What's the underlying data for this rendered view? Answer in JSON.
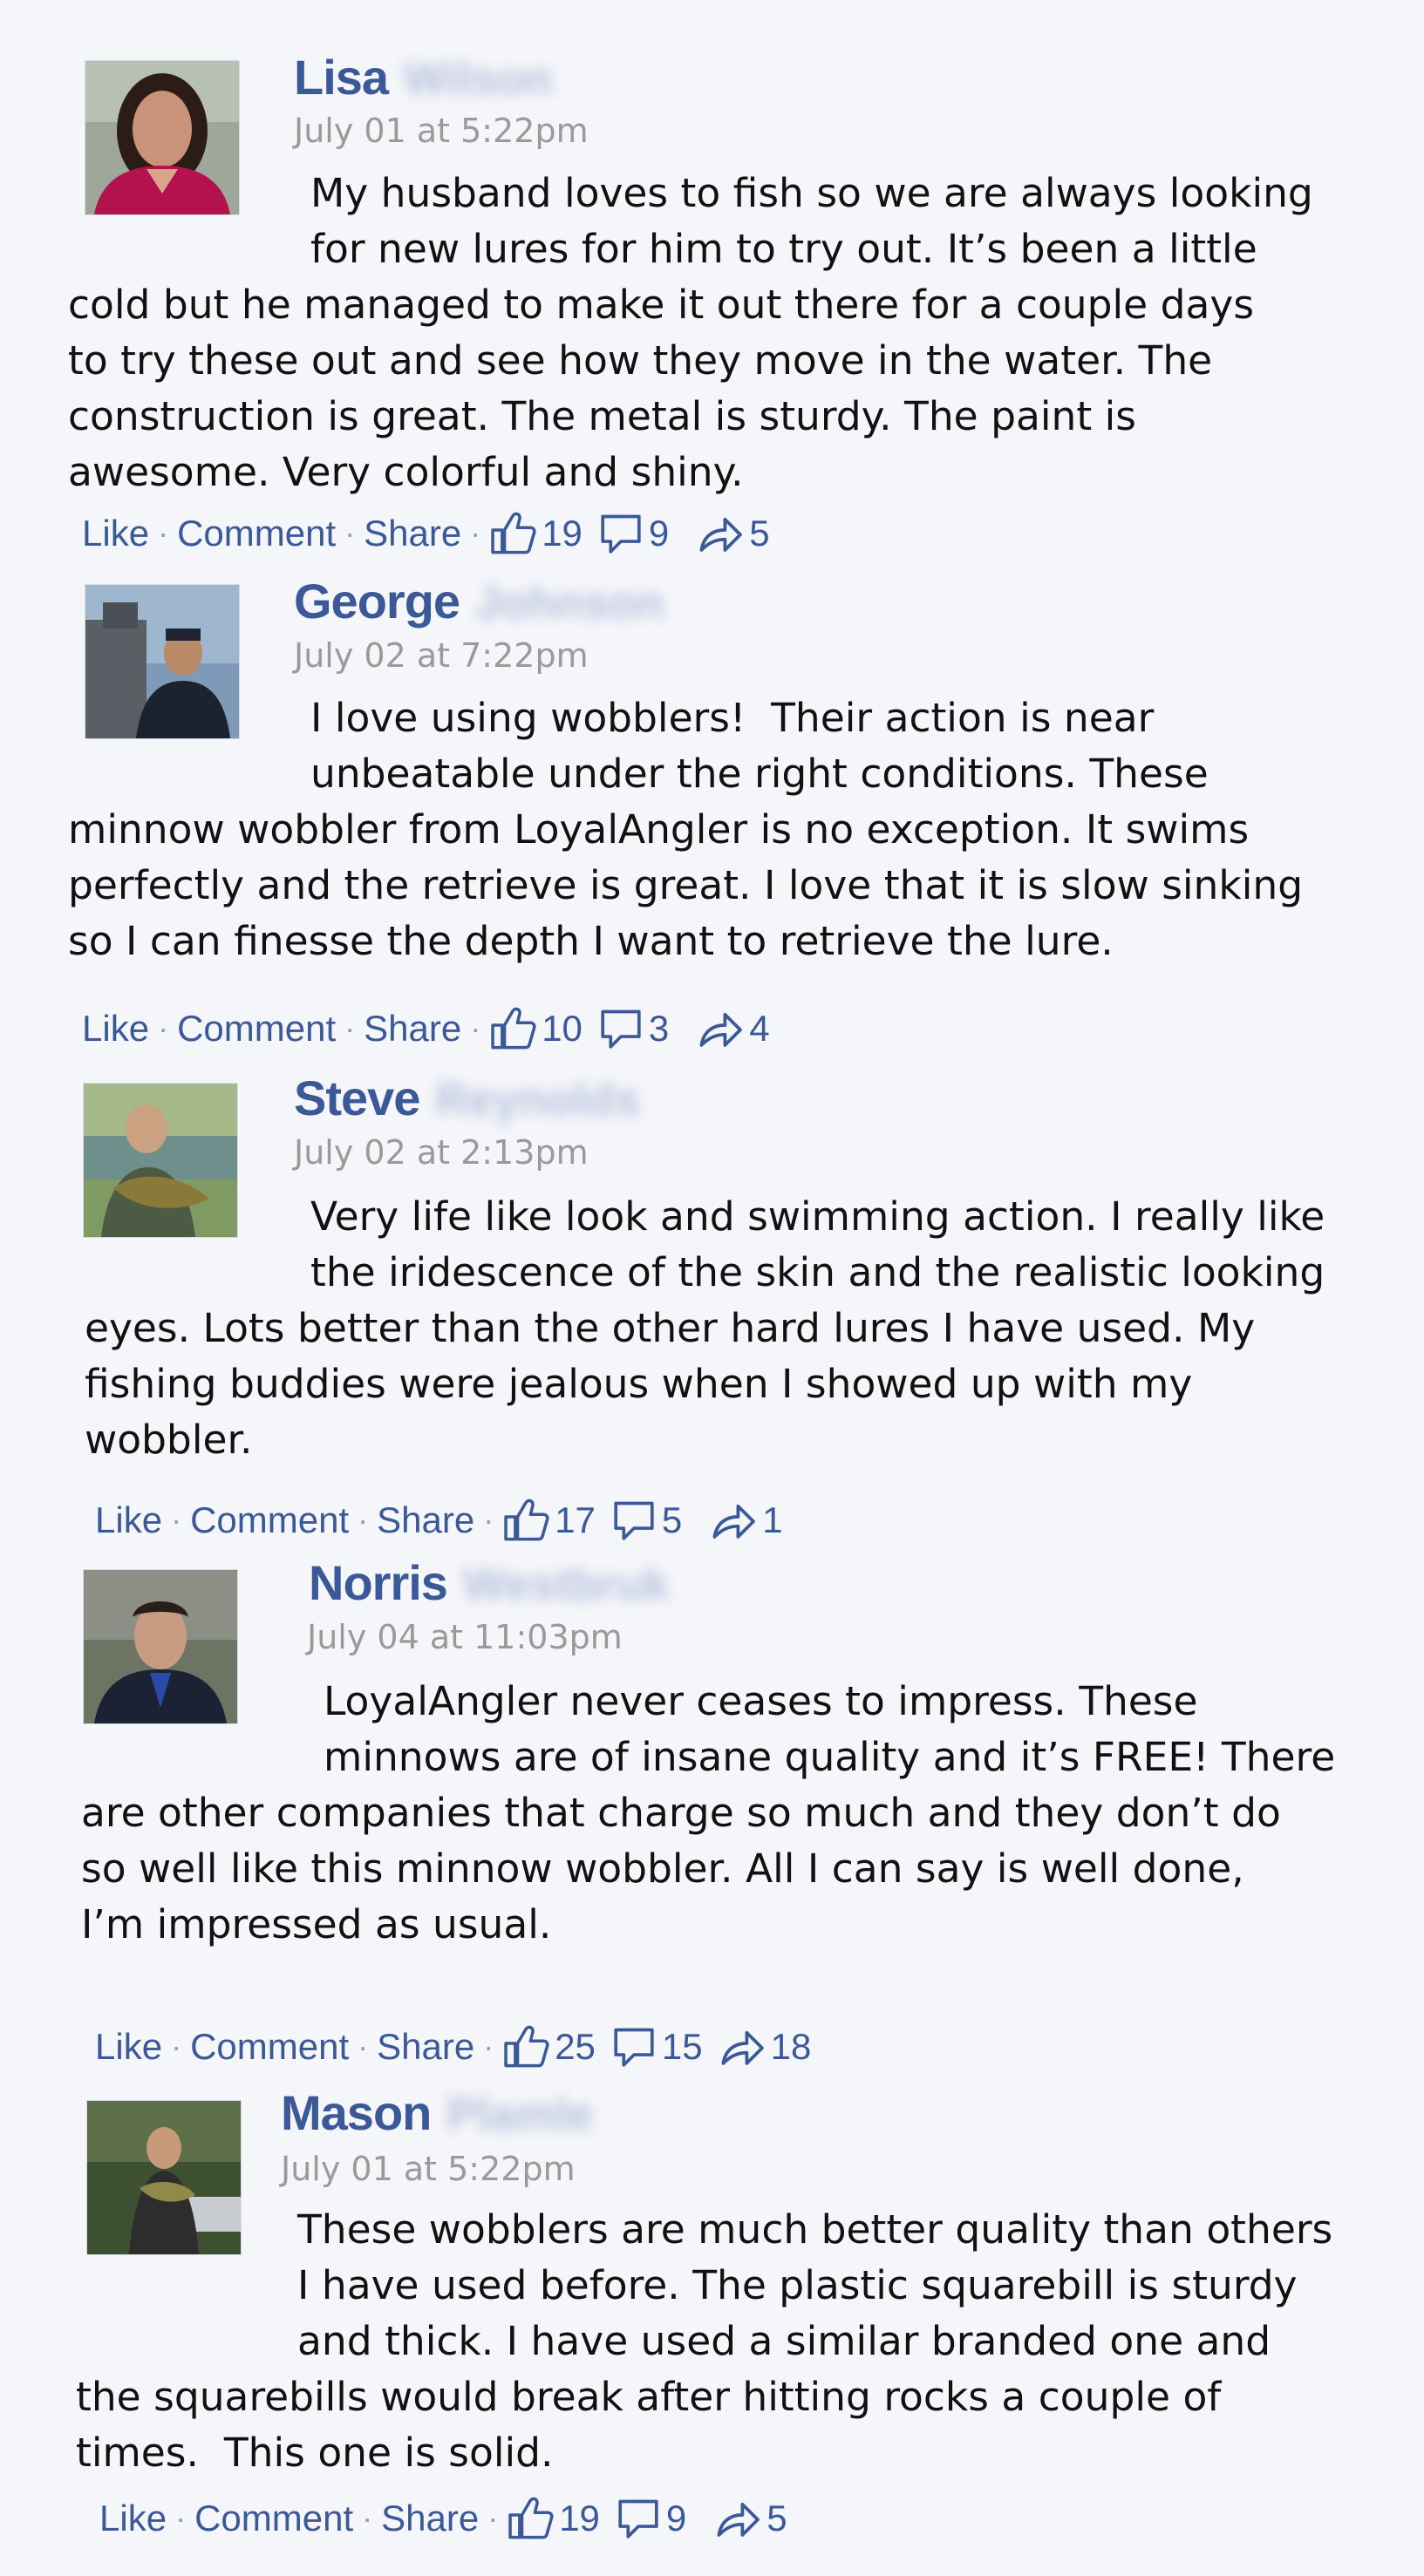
{
  "actions": {
    "like": "Like",
    "comment": "Comment",
    "share": "Share",
    "sep": "·"
  },
  "colors": {
    "link": "#3b5998",
    "timestamp": "#9a9a9a",
    "text": "#111111",
    "background": "#f5f6fa"
  },
  "comments": [
    {
      "first_name": "Lisa",
      "last_name": "Wilson",
      "timestamp": "July 01 at 5:22pm",
      "lines_indented": [
        "My husband loves to fish so we are always looking",
        "for new lures for him to try out. It’s been a little"
      ],
      "lines_full": [
        "cold but he managed to make it out there for a couple days",
        "to try these out and see how they move in the water. The",
        "construction is great. The metal is sturdy. The paint is",
        "awesome. Very colorful and shiny."
      ],
      "likes": "19",
      "comments": "9",
      "shares": "5"
    },
    {
      "first_name": "George",
      "last_name": "Johnson",
      "timestamp": "July 02 at 7:22pm",
      "lines_indented": [
        "I love using wobblers!  Their action is near",
        "unbeatable under the right conditions. These"
      ],
      "lines_full": [
        "minnow wobbler from LoyalAngler is no exception. It swims",
        "perfectly and the retrieve is great. I love that it is slow sinking",
        "so I can finesse the depth I want to retrieve the lure."
      ],
      "likes": "10",
      "comments": "3",
      "shares": "4"
    },
    {
      "first_name": "Steve",
      "last_name": "Reynolds",
      "timestamp": "July 02 at 2:13pm",
      "lines_indented": [
        "Very life like look and swimming action. I really like",
        "the iridescence of the skin and the realistic looking"
      ],
      "lines_full": [
        "eyes. Lots better than the other hard lures I have used. My",
        "fishing buddies were jealous when I showed up with my",
        "wobbler."
      ],
      "likes": "17",
      "comments": "5",
      "shares": "1"
    },
    {
      "first_name": "Norris",
      "last_name": "Westbruk",
      "timestamp": "July 04 at 11:03pm",
      "lines_indented": [
        "LoyalAngler never ceases to impress. These",
        "minnows are of insane quality and it’s FREE! There"
      ],
      "lines_full": [
        "are other companies that charge so much and they don’t do",
        "so well like this minnow wobbler. All I can say is well done,",
        "I’m impressed as usual."
      ],
      "likes": "25",
      "comments": "15",
      "shares": "18"
    },
    {
      "first_name": "Mason",
      "last_name": "Plamle",
      "timestamp": "July 01 at 5:22pm",
      "lines_indented": [
        "These wobblers are much better quality than others",
        "I have used before. The plastic squarebill is sturdy",
        "and thick. I have used a similar branded one and"
      ],
      "lines_full": [
        "the squarebills would break after hitting rocks a couple of",
        "times.  This one is solid."
      ],
      "likes": "19",
      "comments": "9",
      "shares": "5"
    }
  ]
}
